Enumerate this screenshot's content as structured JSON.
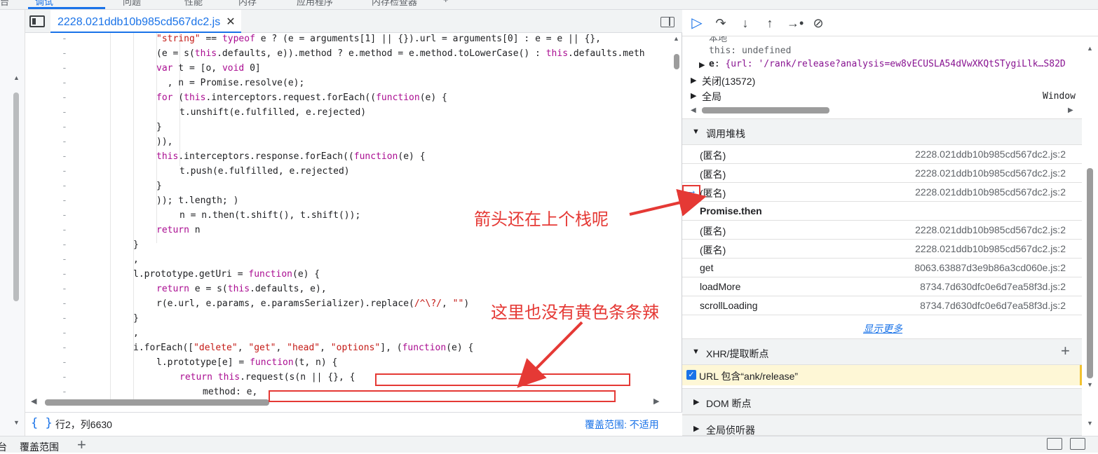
{
  "top_tabs": [
    "调试",
    "问题",
    "性能",
    "内存",
    "应用程序",
    "内存检查器"
  ],
  "editor": {
    "file_tab": "2228.021ddb10b985cd567dc2.js",
    "status_position": "行2，列6630",
    "status_coverage": "覆盖范围: 不适用"
  },
  "code_lines": [
    {
      "indent": 2,
      "segs": [
        [
          "str",
          "\"string\""
        ],
        [
          "t",
          " == "
        ],
        [
          "kw",
          "typeof"
        ],
        [
          "t",
          " e ? (e = arguments[1] || {}).url = arguments[0] : e = e || {},"
        ]
      ]
    },
    {
      "indent": 2,
      "segs": [
        [
          "t",
          "(e = s("
        ],
        [
          "th",
          "this"
        ],
        [
          "t",
          ".defaults, e)).method ? e.method = e.method.toLowerCase() : "
        ],
        [
          "th",
          "this"
        ],
        [
          "t",
          ".defaults.meth"
        ]
      ]
    },
    {
      "indent": 2,
      "segs": [
        [
          "kw",
          "var"
        ],
        [
          "t",
          " t = [o, "
        ],
        [
          "kw",
          "void"
        ],
        [
          "t",
          " 0]"
        ]
      ]
    },
    {
      "indent": 2,
      "segs": [
        [
          "t",
          "  , n = Promise.resolve(e);"
        ]
      ]
    },
    {
      "indent": 2,
      "segs": [
        [
          "kw",
          "for"
        ],
        [
          "t",
          " ("
        ],
        [
          "th",
          "this"
        ],
        [
          "t",
          ".interceptors.request.forEach(("
        ],
        [
          "kw",
          "function"
        ],
        [
          "t",
          "(e) {"
        ]
      ]
    },
    {
      "indent": 3,
      "segs": [
        [
          "t",
          "t.unshift(e.fulfilled, e.rejected)"
        ]
      ]
    },
    {
      "indent": 2,
      "segs": [
        [
          "t",
          "}"
        ]
      ]
    },
    {
      "indent": 2,
      "segs": [
        [
          "t",
          ")),"
        ]
      ]
    },
    {
      "indent": 2,
      "segs": [
        [
          "th",
          "this"
        ],
        [
          "t",
          ".interceptors.response.forEach(("
        ],
        [
          "kw",
          "function"
        ],
        [
          "t",
          "(e) {"
        ]
      ]
    },
    {
      "indent": 3,
      "segs": [
        [
          "t",
          "t.push(e.fulfilled, e.rejected)"
        ]
      ]
    },
    {
      "indent": 2,
      "segs": [
        [
          "t",
          "}"
        ]
      ]
    },
    {
      "indent": 2,
      "segs": [
        [
          "t",
          ")); t.length; )"
        ]
      ]
    },
    {
      "indent": 3,
      "segs": [
        [
          "t",
          "n = n.then(t.shift(), t.shift());"
        ]
      ]
    },
    {
      "indent": 2,
      "segs": [
        [
          "kw",
          "return"
        ],
        [
          "t",
          " n"
        ]
      ]
    },
    {
      "indent": 1,
      "segs": [
        [
          "t",
          "}"
        ]
      ]
    },
    {
      "indent": 1,
      "segs": [
        [
          "t",
          ","
        ]
      ]
    },
    {
      "indent": 1,
      "segs": [
        [
          "t",
          "l.prototype.getUri = "
        ],
        [
          "kw",
          "function"
        ],
        [
          "t",
          "(e) {"
        ]
      ]
    },
    {
      "indent": 2,
      "segs": [
        [
          "kw",
          "return"
        ],
        [
          "t",
          " e = s("
        ],
        [
          "th",
          "this"
        ],
        [
          "t",
          ".defaults, e),"
        ]
      ]
    },
    {
      "indent": 2,
      "segs": [
        [
          "t",
          "r(e.url, e.params, e.paramsSerializer).replace("
        ],
        [
          "str",
          "/^\\?/"
        ],
        [
          "t",
          ", "
        ],
        [
          "str",
          "\"\""
        ],
        [
          "t",
          ")"
        ]
      ]
    },
    {
      "indent": 1,
      "segs": [
        [
          "t",
          "}"
        ]
      ]
    },
    {
      "indent": 1,
      "segs": [
        [
          "t",
          ","
        ]
      ]
    },
    {
      "indent": 1,
      "segs": [
        [
          "t",
          "i.forEach(["
        ],
        [
          "str",
          "\"delete\""
        ],
        [
          "t",
          ", "
        ],
        [
          "str",
          "\"get\""
        ],
        [
          "t",
          ", "
        ],
        [
          "str",
          "\"head\""
        ],
        [
          "t",
          ", "
        ],
        [
          "str",
          "\"options\""
        ],
        [
          "t",
          "], ("
        ],
        [
          "kw",
          "function"
        ],
        [
          "t",
          "(e) {"
        ]
      ]
    },
    {
      "indent": 2,
      "segs": [
        [
          "t",
          "l.prototype[e] = "
        ],
        [
          "kw",
          "function"
        ],
        [
          "t",
          "(t, n) {"
        ]
      ]
    },
    {
      "indent": 3,
      "segs": [
        [
          "kw",
          "return"
        ],
        [
          "t",
          " "
        ],
        [
          "th",
          "this"
        ],
        [
          "t",
          ".request(s(n || {}, {"
        ]
      ]
    },
    {
      "indent": 4,
      "segs": [
        [
          "t",
          "method: e,"
        ]
      ]
    }
  ],
  "scope": {
    "cut_top": "本地",
    "this_line": "this: undefined",
    "e_key": "e",
    "e_value": "{url: '/rank/release?analysis=ew8vECUSLA54dVwXKQtSTygiLlk…S82D",
    "closure": "关闭(13572)",
    "global": "全局",
    "global_value": "Window"
  },
  "callstack": {
    "title": "调用堆栈",
    "frames": [
      {
        "fn": "(匿名)",
        "loc": "2228.021ddb10b985cd567dc2.js:2"
      },
      {
        "fn": "(匿名)",
        "loc": "2228.021ddb10b985cd567dc2.js:2"
      },
      {
        "fn": "(匿名)",
        "loc": "2228.021ddb10b985cd567dc2.js:2",
        "current": true
      },
      {
        "fn": "Promise.then",
        "loc": "",
        "separator": true
      },
      {
        "fn": "(匿名)",
        "loc": "2228.021ddb10b985cd567dc2.js:2"
      },
      {
        "fn": "(匿名)",
        "loc": "2228.021ddb10b985cd567dc2.js:2"
      },
      {
        "fn": "get",
        "loc": "8063.63887d3e9b86a3cd060e.js:2"
      },
      {
        "fn": "loadMore",
        "loc": "8734.7d630dfc0e6d7ea58f3d.js:2"
      },
      {
        "fn": "scrollLoading",
        "loc": "8734.7d630dfc0e6d7ea58f3d.js:2"
      }
    ],
    "show_more": "显示更多"
  },
  "xhr": {
    "title": "XHR/提取断点",
    "item": "URL 包含“ank/release”"
  },
  "dom_bp": "DOM 断点",
  "global_listeners": "全局侦听器",
  "bottom": {
    "coverage": "覆盖范围"
  },
  "annotations": {
    "arrow_note": "箭头还在上个栈呢",
    "yellow_note": "这里也没有黄色条条辣"
  },
  "colors": {
    "accent": "#1a73e8",
    "annotation_red": "#e53935",
    "breakpoint_yellow": "#fef7d6"
  }
}
